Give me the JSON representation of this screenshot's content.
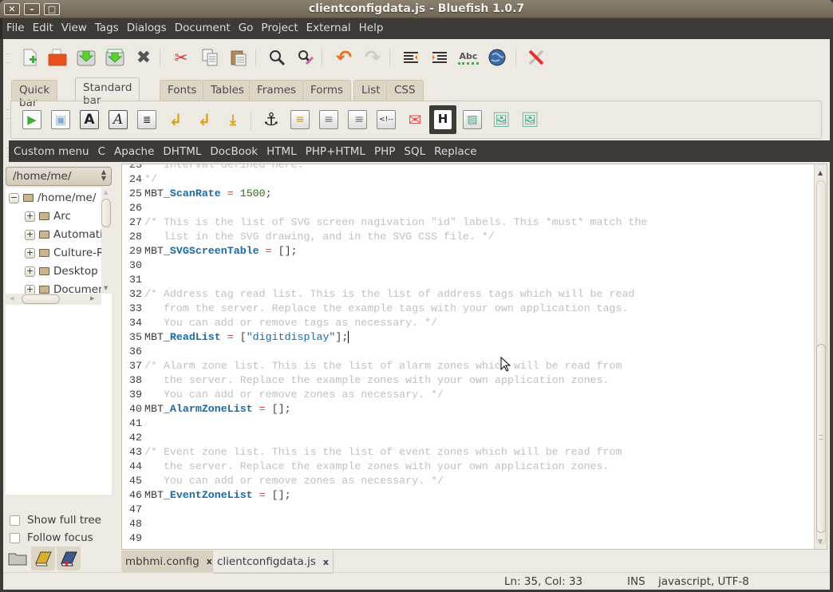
{
  "window": {
    "title": "clientconfigdata.js - Bluefish 1.0.7",
    "controls": [
      "close",
      "minimize",
      "maximize"
    ]
  },
  "menubar": [
    "File",
    "Edit",
    "View",
    "Tags",
    "Dialogs",
    "Document",
    "Go",
    "Project",
    "External",
    "Help"
  ],
  "toolbar": [
    {
      "name": "new-file",
      "glyph": "📄"
    },
    {
      "name": "open-file",
      "glyph": "📂"
    },
    {
      "name": "save",
      "glyph": "💾"
    },
    {
      "name": "save-as",
      "glyph": "💾"
    },
    {
      "name": "close",
      "glyph": "✖"
    },
    {
      "name": "cut",
      "glyph": "✂"
    },
    {
      "name": "copy",
      "glyph": "⧉"
    },
    {
      "name": "paste",
      "glyph": "📋"
    },
    {
      "name": "find",
      "glyph": "🔍"
    },
    {
      "name": "replace",
      "glyph": "🔎"
    },
    {
      "name": "undo",
      "glyph": "↶"
    },
    {
      "name": "redo",
      "glyph": "↷"
    },
    {
      "name": "unindent",
      "glyph": "⇤"
    },
    {
      "name": "indent",
      "glyph": "⇥"
    },
    {
      "name": "spell-check",
      "glyph": "Abc"
    },
    {
      "name": "preview-browser",
      "glyph": "🌐"
    },
    {
      "name": "preferences",
      "glyph": "🔧"
    }
  ],
  "html_tabs": {
    "items": [
      "Quick bar",
      "Standard bar",
      "Fonts",
      "Tables",
      "Frames",
      "Forms",
      "List",
      "CSS"
    ],
    "active": "Standard bar"
  },
  "standard_bar": [
    {
      "name": "quickstart",
      "glyph": "▷"
    },
    {
      "name": "body",
      "glyph": "▢"
    },
    {
      "name": "bold",
      "glyph": "A"
    },
    {
      "name": "italic",
      "glyph": "A"
    },
    {
      "name": "paragraph",
      "glyph": "¶"
    },
    {
      "name": "break",
      "glyph": "↵"
    },
    {
      "name": "break-clear",
      "glyph": "↵"
    },
    {
      "name": "nbsp",
      "glyph": "⤓"
    },
    {
      "name": "anchor",
      "glyph": "⚓"
    },
    {
      "name": "rule",
      "glyph": "≡"
    },
    {
      "name": "center",
      "glyph": "≡"
    },
    {
      "name": "right-justify",
      "glyph": "≡"
    },
    {
      "name": "comment",
      "glyph": "<!"
    },
    {
      "name": "email",
      "glyph": "✉"
    },
    {
      "name": "heading",
      "glyph": "H"
    },
    {
      "name": "insert-image",
      "glyph": "🖼"
    },
    {
      "name": "insert-thumbnail",
      "glyph": "🖼"
    },
    {
      "name": "multi-thumbnail",
      "glyph": "🖼"
    }
  ],
  "custom_menu": [
    "Custom menu",
    "C",
    "Apache",
    "DHTML",
    "DocBook",
    "HTML",
    "PHP+HTML",
    "PHP",
    "SQL",
    "Replace"
  ],
  "filebrowser": {
    "location": "/home/me/",
    "root": "/home/me/",
    "folders": [
      "Arc",
      "Automatio",
      "Culture-Re",
      "Desktop",
      "Documen"
    ],
    "show_full_tree_label": "Show full tree",
    "follow_focus_label": "Follow focus",
    "show_full_tree": false,
    "follow_focus": false
  },
  "sidebar_tabs": [
    "filebrowser",
    "functions",
    "bookmarks"
  ],
  "editor": {
    "lines": [
      {
        "n": "23",
        "parts": [
          {
            "t": "cm",
            "v": "   interval defined here."
          }
        ]
      },
      {
        "n": "24",
        "parts": [
          {
            "t": "cm",
            "v": "*/"
          }
        ]
      },
      {
        "n": "25",
        "parts": [
          {
            "t": "pl",
            "v": "MBT_"
          },
          {
            "t": "id",
            "v": "ScanRate"
          },
          {
            "t": "pl",
            "v": " "
          },
          {
            "t": "op",
            "v": "="
          },
          {
            "t": "pl",
            "v": " "
          },
          {
            "t": "num",
            "v": "1500"
          },
          {
            "t": "pl",
            "v": ";"
          }
        ]
      },
      {
        "n": "26",
        "parts": []
      },
      {
        "n": "27",
        "parts": [
          {
            "t": "cm",
            "v": "/* This is the list of SVG screen nagivation \"id\" labels. This *must* match the"
          }
        ]
      },
      {
        "n": "28",
        "parts": [
          {
            "t": "cm",
            "v": "   list in the SVG drawing, and in the SVG CSS file. */"
          }
        ]
      },
      {
        "n": "29",
        "parts": [
          {
            "t": "pl",
            "v": "MBT_"
          },
          {
            "t": "id",
            "v": "SVGScreenTable"
          },
          {
            "t": "pl",
            "v": " "
          },
          {
            "t": "op",
            "v": "="
          },
          {
            "t": "pl",
            "v": " [];"
          }
        ]
      },
      {
        "n": "30",
        "parts": []
      },
      {
        "n": "31",
        "parts": []
      },
      {
        "n": "32",
        "parts": [
          {
            "t": "cm",
            "v": "/* Address tag read list. This is the list of address tags which will be read"
          }
        ]
      },
      {
        "n": "33",
        "parts": [
          {
            "t": "cm",
            "v": "   from the server. Replace the example tags with your own application tags."
          }
        ]
      },
      {
        "n": "34",
        "parts": [
          {
            "t": "cm",
            "v": "   You can add or remove tags as necessary. */"
          }
        ]
      },
      {
        "n": "35",
        "parts": [
          {
            "t": "pl",
            "v": "MBT_"
          },
          {
            "t": "id",
            "v": "ReadList"
          },
          {
            "t": "pl",
            "v": " "
          },
          {
            "t": "op",
            "v": "="
          },
          {
            "t": "pl",
            "v": " ["
          },
          {
            "t": "str",
            "v": "\"digitdisplay\""
          },
          {
            "t": "pl",
            "v": "];"
          }
        ],
        "caret": true
      },
      {
        "n": "36",
        "parts": []
      },
      {
        "n": "37",
        "parts": [
          {
            "t": "cm",
            "v": "/* Alarm zone list. This is the list of alarm zones which will be read from"
          }
        ]
      },
      {
        "n": "38",
        "parts": [
          {
            "t": "cm",
            "v": "   the server. Replace the example zones with your own application zones."
          }
        ]
      },
      {
        "n": "39",
        "parts": [
          {
            "t": "cm",
            "v": "   You can add or remove zones as necessary. */"
          }
        ]
      },
      {
        "n": "40",
        "parts": [
          {
            "t": "pl",
            "v": "MBT_"
          },
          {
            "t": "id",
            "v": "AlarmZoneList"
          },
          {
            "t": "pl",
            "v": " "
          },
          {
            "t": "op",
            "v": "="
          },
          {
            "t": "pl",
            "v": " [];"
          }
        ]
      },
      {
        "n": "41",
        "parts": []
      },
      {
        "n": "42",
        "parts": []
      },
      {
        "n": "43",
        "parts": [
          {
            "t": "cm",
            "v": "/* Event zone list. This is the list of event zones which will be read from"
          }
        ]
      },
      {
        "n": "44",
        "parts": [
          {
            "t": "cm",
            "v": "   the server. Replace the example zones with your own application zones."
          }
        ]
      },
      {
        "n": "45",
        "parts": [
          {
            "t": "cm",
            "v": "   You can add or remove zones as necessary. */"
          }
        ]
      },
      {
        "n": "46",
        "parts": [
          {
            "t": "pl",
            "v": "MBT_"
          },
          {
            "t": "id",
            "v": "EventZoneList"
          },
          {
            "t": "pl",
            "v": " "
          },
          {
            "t": "op",
            "v": "="
          },
          {
            "t": "pl",
            "v": " [];"
          }
        ]
      },
      {
        "n": "47",
        "parts": []
      },
      {
        "n": "48",
        "parts": []
      },
      {
        "n": "49",
        "parts": []
      }
    ]
  },
  "document_tabs": [
    {
      "label": "mbhmi.config",
      "active": false,
      "close": "x"
    },
    {
      "label": "clientconfigdata.js",
      "active": true,
      "close": "x"
    }
  ],
  "statusbar": {
    "position": "Ln: 35, Col: 33",
    "mode": "INS",
    "filetype": "javascript, UTF-8"
  },
  "colors": {
    "titlebar": "#7a705f",
    "menubar": "#3c3b37",
    "window_bg": "#edeae3",
    "comment": "#c0c0c0",
    "identifier": "#1a6aa5",
    "operator": "#e24444",
    "number": "#2c6a1a"
  }
}
